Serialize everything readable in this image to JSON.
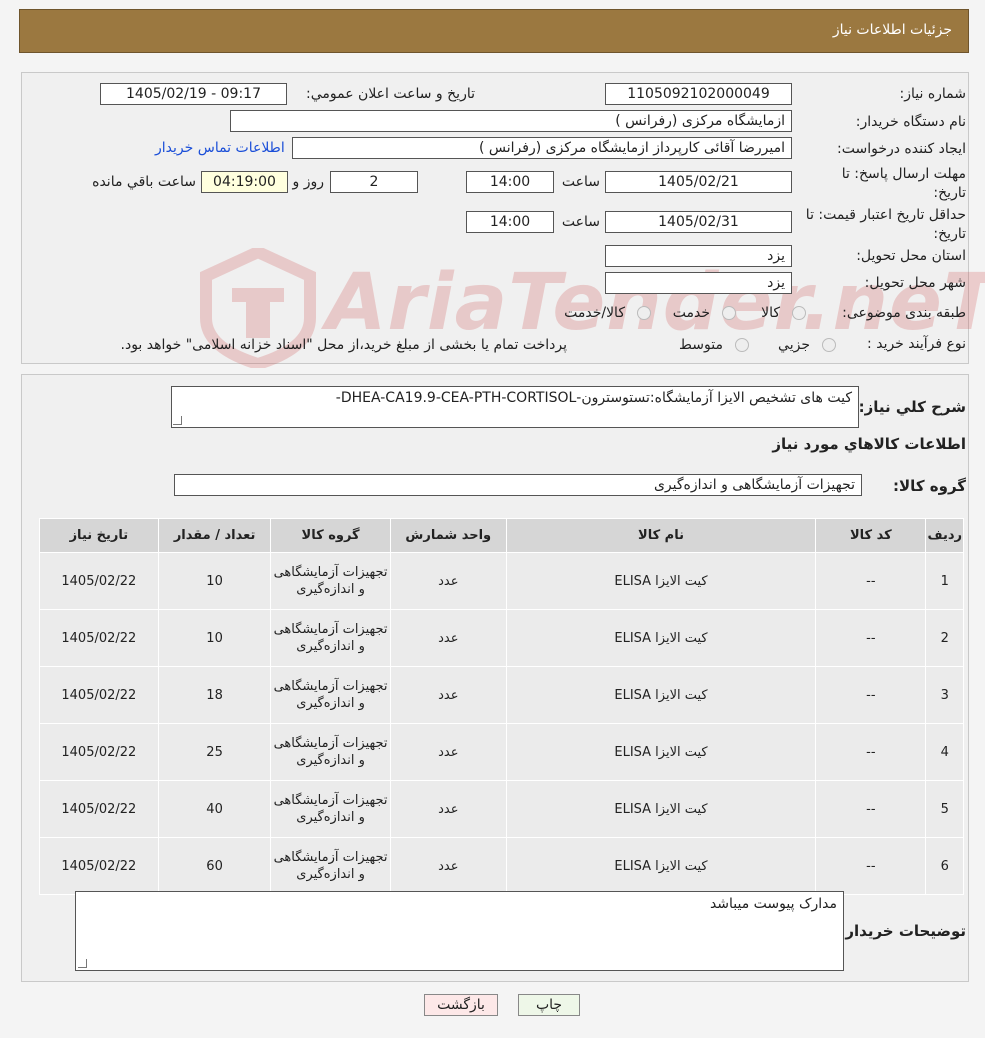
{
  "header": {
    "title": "جزئیات اطلاعات نیاز"
  },
  "form": {
    "need_number_label": "شماره نیاز:",
    "need_number": "1105092102000049",
    "announce_label": "تاریخ و ساعت اعلان عمومي:",
    "announce_value": "1405/02/19 - 09:17",
    "buyer_org_label": "نام دستگاه خریدار:",
    "buyer_org": "ازمایشگاه مرکزی (رفرانس )",
    "creator_label": "ایجاد کننده درخواست:",
    "creator": "امیررضا آقائی کارپرداز ازمایشگاه مرکزی (رفرانس )",
    "contact_link": "اطلاعات تماس خریدار",
    "deadline_label_1": "مهلت ارسال پاسخ: تا",
    "deadline_label_2": "تاریخ:",
    "deadline_date": "1405/02/21",
    "time_label": "ساعت",
    "deadline_time": "14:00",
    "days_value": "2",
    "days_label": "روز و",
    "remaining_value": "04:19:00",
    "remaining_label": "ساعت باقي مانده",
    "validity_label_1": "حداقل تاریخ اعتبار قیمت: تا",
    "validity_label_2": "تاریخ:",
    "validity_date": "1405/02/31",
    "validity_time_label": "ساعت",
    "validity_time": "14:00",
    "province_label": "استان محل تحویل:",
    "province": "یزد",
    "city_label": "شهر محل تحویل:",
    "city": "یزد",
    "category_label": "طبقه بندی موضوعی:",
    "category_options": [
      "کالا",
      "خدمت",
      "کالا/خدمت"
    ],
    "process_label": "نوع فرآیند خرید :",
    "process_options": [
      "جزیي",
      "متوسط"
    ],
    "process_note": "پرداخت تمام یا بخشی از مبلغ خرید،از محل \"اسناد خزانه اسلامی\" خواهد بود."
  },
  "details": {
    "description_label": "شرح کلي نیاز:",
    "description": "کیت های تشخیص الایزا آزمایشگاه:تستوسترون-DHEA-CA19.9-CEA-PTH-CORTISOL-",
    "goods_info_title": "اطلاعات کالاهاي مورد نیاز",
    "goods_group_label": "گروه کالا:",
    "goods_group": "تجهیزات آزمایشگاهی و اندازه‌گیری"
  },
  "table": {
    "headers": [
      "ردیف",
      "کد کالا",
      "نام کالا",
      "واحد شمارش",
      "گروه کالا",
      "تعداد / مقدار",
      "تاریخ نیاز"
    ],
    "rows": [
      [
        "1",
        "--",
        "کیت الایزا ELISA",
        "عدد",
        "تجهیزات آزمایشگاهی و اندازه‌گیری",
        "10",
        "1405/02/22"
      ],
      [
        "2",
        "--",
        "کیت الایزا ELISA",
        "عدد",
        "تجهیزات آزمایشگاهی و اندازه‌گیری",
        "10",
        "1405/02/22"
      ],
      [
        "3",
        "--",
        "کیت الایزا ELISA",
        "عدد",
        "تجهیزات آزمایشگاهی و اندازه‌گیری",
        "18",
        "1405/02/22"
      ],
      [
        "4",
        "--",
        "کیت الایزا ELISA",
        "عدد",
        "تجهیزات آزمایشگاهی و اندازه‌گیری",
        "25",
        "1405/02/22"
      ],
      [
        "5",
        "--",
        "کیت الایزا ELISA",
        "عدد",
        "تجهیزات آزمایشگاهی و اندازه‌گیری",
        "40",
        "1405/02/22"
      ],
      [
        "6",
        "--",
        "کیت الایزا ELISA",
        "عدد",
        "تجهیزات آزمایشگاهی و اندازه‌گیری",
        "60",
        "1405/02/22"
      ]
    ]
  },
  "notes": {
    "label": "توضیحات خریدار:",
    "value": "مدارک پیوست میباشد"
  },
  "buttons": {
    "print": "چاپ",
    "back": "بازگشت"
  },
  "watermark": {
    "text": "AriaTender.neT"
  },
  "colors": {
    "header_bg": "#9b7840",
    "link": "#1a4ed8",
    "back_button": "#fde8e8",
    "print_button": "#eef7e8"
  }
}
